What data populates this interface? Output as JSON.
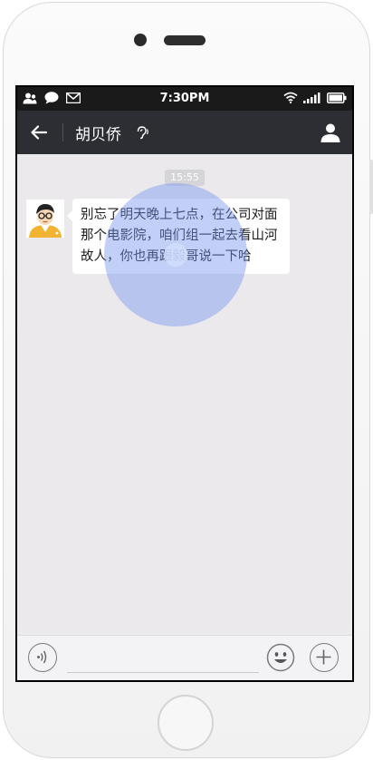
{
  "status_bar": {
    "time": "7:30PM",
    "left_icons": [
      "contacts-icon",
      "chat-icon",
      "mail-icon"
    ],
    "right_icons": [
      "wifi-icon",
      "signal-icon",
      "battery-icon"
    ]
  },
  "header": {
    "title": "胡贝侨",
    "back_icon": "back-arrow-icon",
    "earpiece_icon": "ear-icon",
    "profile_icon": "user-icon"
  },
  "chat": {
    "timestamp": "15:55",
    "messages": [
      {
        "sender": "other",
        "text": "别忘了明天晚上七点，在公司对面那个电影院，咱们组一起去看山河故人，你也再跟毅哥说一下哈"
      }
    ]
  },
  "input_bar": {
    "value": "",
    "voice_icon": "voice-icon",
    "emoji_icon": "emoji-icon",
    "more_icon": "plus-icon"
  },
  "colors": {
    "header_bg": "#2d2e33",
    "chat_bg": "#ebe9ec",
    "bubble_bg": "#ffffff",
    "touch_indicator": "#7896f0"
  }
}
